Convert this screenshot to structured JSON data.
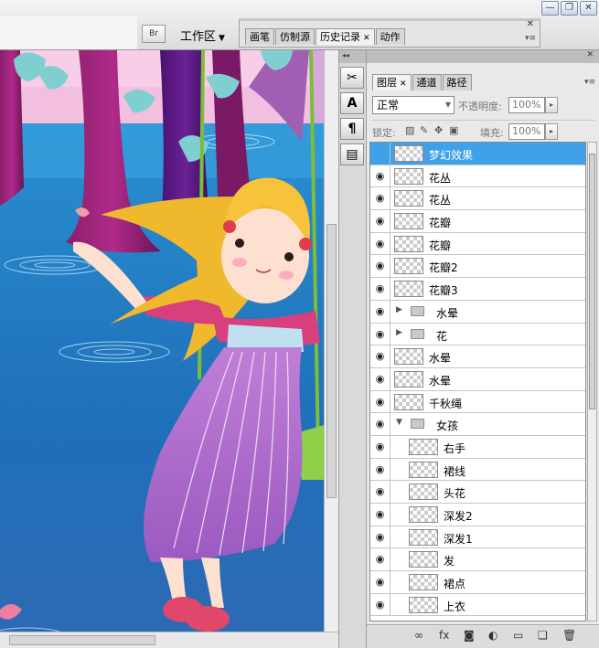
{
  "colors": {
    "selected_row": "#3fa1e8"
  },
  "window": {
    "restore_label": "❐",
    "minimize_label": "—",
    "close_label": "✕"
  },
  "toolbar": {
    "bridge_label": "Br",
    "workspace_label": "工作区",
    "workspace_arrow": "▼"
  },
  "dock": {
    "tabs": [
      {
        "label": "画笔",
        "active": false
      },
      {
        "label": "仿制源",
        "active": false
      },
      {
        "label": "历史记录",
        "active": true
      },
      {
        "label": "动作",
        "active": false
      }
    ],
    "close_label": "✕",
    "tab_close": "✕",
    "menu_label": "▾≡"
  },
  "tools": {
    "header_label": "◂◂",
    "buttons": [
      {
        "name": "brush-tool-icon",
        "glyph": "✂"
      },
      {
        "name": "character-tool-icon",
        "glyph": "A"
      },
      {
        "name": "paragraph-tool-icon",
        "glyph": "¶"
      },
      {
        "name": "layer-comps-tool-icon",
        "glyph": "▤"
      }
    ]
  },
  "layers_panel": {
    "header_close": "✕",
    "header_collapse": "▸▸",
    "tabs": [
      {
        "label": "图层",
        "active": true,
        "close": "✕"
      },
      {
        "label": "通道",
        "active": false
      },
      {
        "label": "路径",
        "active": false
      }
    ],
    "menu_label": "▾≡",
    "blend_mode": "正常",
    "opacity_label": "不透明度:",
    "opacity_value": "100%",
    "lock_label": "锁定:",
    "fill_label": "填充:",
    "fill_value": "100%",
    "layers": [
      {
        "name": "梦幻效果",
        "visible": false,
        "selected": true,
        "type": "layer",
        "indent": 0
      },
      {
        "name": "花丛",
        "visible": true,
        "selected": false,
        "type": "layer",
        "indent": 0
      },
      {
        "name": "花丛",
        "visible": true,
        "selected": false,
        "type": "layer",
        "indent": 0
      },
      {
        "name": "花瓣",
        "visible": true,
        "selected": false,
        "type": "layer",
        "indent": 0
      },
      {
        "name": "花瓣",
        "visible": true,
        "selected": false,
        "type": "layer",
        "indent": 0
      },
      {
        "name": "花瓣2",
        "visible": true,
        "selected": false,
        "type": "layer",
        "indent": 0
      },
      {
        "name": "花瓣3",
        "visible": true,
        "selected": false,
        "type": "layer",
        "indent": 0
      },
      {
        "name": "水晕",
        "visible": true,
        "selected": false,
        "type": "group",
        "expanded": false,
        "indent": 0
      },
      {
        "name": "花",
        "visible": true,
        "selected": false,
        "type": "group",
        "expanded": false,
        "indent": 0
      },
      {
        "name": "水晕",
        "visible": true,
        "selected": false,
        "type": "layer",
        "indent": 0
      },
      {
        "name": "水晕",
        "visible": true,
        "selected": false,
        "type": "layer",
        "indent": 0
      },
      {
        "name": "千秋绳",
        "visible": true,
        "selected": false,
        "type": "layer",
        "indent": 0
      },
      {
        "name": "女孩",
        "visible": true,
        "selected": false,
        "type": "group",
        "expanded": true,
        "indent": 0
      },
      {
        "name": "右手",
        "visible": true,
        "selected": false,
        "type": "layer",
        "indent": 1
      },
      {
        "name": "裙线",
        "visible": true,
        "selected": false,
        "type": "layer",
        "indent": 1
      },
      {
        "name": "头花",
        "visible": true,
        "selected": false,
        "type": "layer",
        "indent": 1
      },
      {
        "name": "深发2",
        "visible": true,
        "selected": false,
        "type": "layer",
        "indent": 1
      },
      {
        "name": "深发1",
        "visible": true,
        "selected": false,
        "type": "layer",
        "indent": 1
      },
      {
        "name": "发",
        "visible": true,
        "selected": false,
        "type": "layer",
        "indent": 1
      },
      {
        "name": "裙点",
        "visible": true,
        "selected": false,
        "type": "layer",
        "indent": 1
      },
      {
        "name": "上衣",
        "visible": true,
        "selected": false,
        "type": "layer",
        "indent": 1
      }
    ],
    "bottom_icons": [
      {
        "name": "link-layers-icon",
        "glyph": "∞"
      },
      {
        "name": "layer-style-icon",
        "glyph": "fx"
      },
      {
        "name": "add-mask-icon",
        "glyph": "◙"
      },
      {
        "name": "adjustment-layer-icon",
        "glyph": "◐"
      },
      {
        "name": "new-group-icon",
        "glyph": "▭"
      },
      {
        "name": "new-layer-icon",
        "glyph": "❏"
      },
      {
        "name": "delete-layer-icon",
        "glyph": "🗑"
      }
    ]
  }
}
